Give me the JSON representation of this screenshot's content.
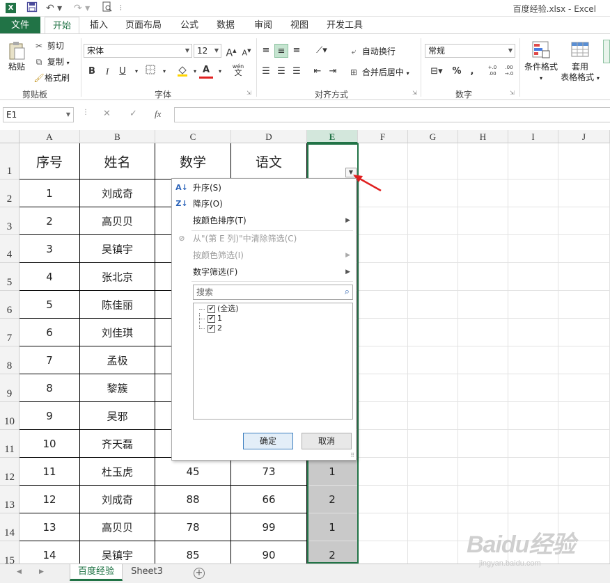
{
  "window": {
    "title": "百度经验.xlsx - Excel",
    "app_icon": "X"
  },
  "qat": {
    "save_icon": "save-icon",
    "undo_icon": "undo-icon",
    "redo_icon": "redo-icon",
    "preview_icon": "print-preview-icon"
  },
  "tabs": {
    "file": "文件",
    "items": [
      "开始",
      "插入",
      "页面布局",
      "公式",
      "数据",
      "审阅",
      "视图",
      "开发工具"
    ],
    "active": "开始"
  },
  "ribbon": {
    "clipboard": {
      "paste": "粘贴",
      "cut": "剪切",
      "copy": "复制",
      "format_painter": "格式刷",
      "label": "剪贴板"
    },
    "font": {
      "name": "宋体",
      "size": "12",
      "bold": "B",
      "italic": "I",
      "underline": "U",
      "wen": "wén",
      "wen_char": "文",
      "label": "字体"
    },
    "alignment": {
      "wrap": "自动换行",
      "merge": "合并后居中",
      "label": "对齐方式"
    },
    "number": {
      "format": "常规",
      "percent": "%",
      "comma": ",",
      "inc_dec": "+.0 .00",
      "dec_dec": ".00 →.0",
      "label": "数字"
    },
    "styles": {
      "conditional": "条件格式",
      "table_line1": "套用",
      "table_line2": "表格格式"
    }
  },
  "formula_bar": {
    "name_box": "E1",
    "cancel": "✕",
    "enter": "✓",
    "fx": "fx",
    "value": ""
  },
  "sheet": {
    "columns": [
      "A",
      "B",
      "C",
      "D",
      "E",
      "F",
      "G",
      "H",
      "I",
      "J"
    ],
    "row_numbers": [
      "1",
      "2",
      "3",
      "4",
      "5",
      "6",
      "7",
      "8",
      "9",
      "10",
      "11",
      "12",
      "13",
      "14",
      "15"
    ],
    "header": [
      "序号",
      "姓名",
      "数学",
      "语文",
      ""
    ],
    "rows": [
      [
        "1",
        "刘成奇",
        "",
        "",
        ""
      ],
      [
        "2",
        "高贝贝",
        "",
        "",
        ""
      ],
      [
        "3",
        "吴镇宇",
        "",
        "",
        ""
      ],
      [
        "4",
        "张北京",
        "",
        "",
        ""
      ],
      [
        "5",
        "陈佳丽",
        "",
        "",
        ""
      ],
      [
        "6",
        "刘佳琪",
        "",
        "",
        ""
      ],
      [
        "7",
        "孟极",
        "",
        "",
        ""
      ],
      [
        "8",
        "黎簇",
        "",
        "",
        ""
      ],
      [
        "9",
        "吴邪",
        "",
        "",
        ""
      ],
      [
        "10",
        "齐天磊",
        "",
        "",
        ""
      ],
      [
        "11",
        "杜玉虎",
        "45",
        "73",
        "1"
      ],
      [
        "12",
        "刘成奇",
        "88",
        "66",
        "2"
      ],
      [
        "13",
        "高贝贝",
        "78",
        "99",
        "1"
      ],
      [
        "14",
        "吴镇宇",
        "85",
        "90",
        "2"
      ]
    ]
  },
  "filter_menu": {
    "sort_asc": "升序(S)",
    "sort_desc": "降序(O)",
    "sort_color": "按颜色排序(T)",
    "clear_filter": "从\"(第 E 列)\"中清除筛选(C)",
    "filter_color": "按颜色筛选(I)",
    "number_filter": "数字筛选(F)",
    "search_placeholder": "搜索",
    "list": [
      "(全选)",
      "1",
      "2"
    ],
    "ok": "确定",
    "cancel": "取消"
  },
  "sheet_tabs": {
    "items": [
      "百度经验",
      "Sheet3"
    ],
    "active": "百度经验",
    "add": "+"
  },
  "watermark": {
    "brand": "Baidu经验",
    "url": "jingyan.baidu.com"
  },
  "colors": {
    "excel_green": "#217346",
    "selected_fill": "#c9c9c9",
    "arrow_red": "#e02020"
  }
}
